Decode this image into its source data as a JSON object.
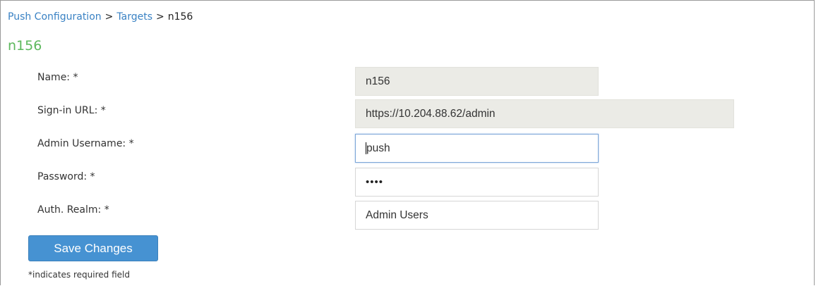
{
  "breadcrumb": {
    "items": [
      "Push Configuration",
      "Targets",
      "n156"
    ],
    "separator": ">"
  },
  "page_title": "n156",
  "form": {
    "name": {
      "label": "Name: *",
      "value": "n156"
    },
    "signin_url": {
      "label": "Sign-in URL: *",
      "value": "https://10.204.88.62/admin"
    },
    "admin_username": {
      "label": "Admin Username: *",
      "value": "push"
    },
    "password": {
      "label": "Password: *",
      "value": "••••"
    },
    "auth_realm": {
      "label": "Auth. Realm: *",
      "value": "Admin Users"
    }
  },
  "save_label": "Save Changes",
  "footnote": "*indicates required field",
  "colors": {
    "title_green": "#5cb85c",
    "link_blue": "#3a82c4",
    "button_blue": "#4692d2"
  }
}
